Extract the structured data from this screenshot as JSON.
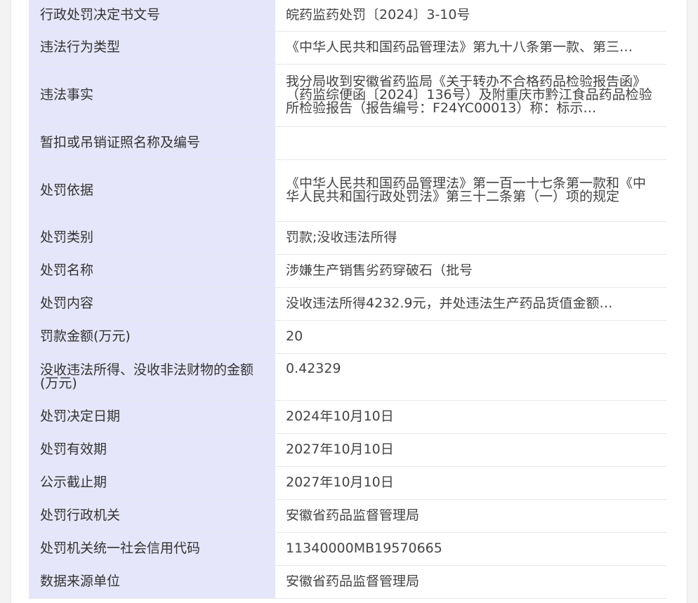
{
  "rows": [
    {
      "label": "行政处罚决定书文号",
      "value": "皖药监药处罚〔2024〕3-10号"
    },
    {
      "label": "违法行为类型",
      "value": "《中华人民共和国药品管理法》第九十八条第一款、第三…"
    },
    {
      "label": "违法事实",
      "value": "我分局收到安徽省药监局《关于转办不合格药品检验报告函》（药监综便函〔2024〕136号）及附重庆市黔江食品药品检验所检验报告（报告编号：F24YC00013）称：标示…"
    },
    {
      "label": "暂扣或吊销证照名称及编号",
      "value": ""
    },
    {
      "label": "处罚依据",
      "value": "《中华人民共和国药品管理法》第一百一十七条第一款和《中华人民共和国行政处罚法》第三十二条第（一）项的规定"
    },
    {
      "label": "处罚类别",
      "value": "罚款;没收违法所得"
    },
    {
      "label": "处罚名称",
      "value": "涉嫌生产销售劣药穿破石（批号"
    },
    {
      "label": "处罚内容",
      "value": "没收违法所得4232.9元，并处违法生产药品货值金额…"
    },
    {
      "label": "罚款金额(万元)",
      "value": "20"
    },
    {
      "label": "没收违法所得、没收非法财物的金额(万元)",
      "value": "0.42329"
    },
    {
      "label": "处罚决定日期",
      "value": "2024年10月10日"
    },
    {
      "label": "处罚有效期",
      "value": "2027年10月10日"
    },
    {
      "label": "公示截止期",
      "value": "2027年10月10日"
    },
    {
      "label": "处罚行政机关",
      "value": "安徽省药品监督管理局"
    },
    {
      "label": "处罚机关统一社会信用代码",
      "value": "11340000MB19570665"
    },
    {
      "label": "数据来源单位",
      "value": "安徽省药品监督管理局"
    }
  ],
  "colors": {
    "label_bg": "#e6e6fa",
    "value_bg": "#ffffff",
    "border": "#e7e7ee",
    "page_bg": "#f3f3f3"
  }
}
